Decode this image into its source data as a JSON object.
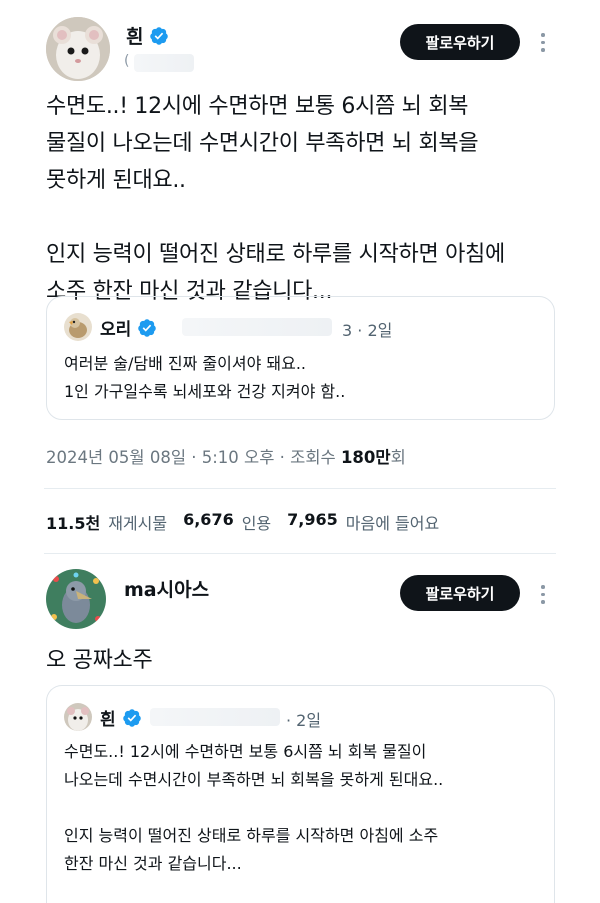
{
  "tweet1": {
    "author": "흰",
    "handle": "(",
    "follow_label": "팔로우하기",
    "text_lines": [
      "수면도..! 12시에 수면하면 보통 6시쯤 뇌 회복",
      "물질이 나오는데 수면시간이 부족하면 뇌 회복을",
      "못하게 된대요..",
      "",
      "인지 능력이 떨어진 상태로 하루를 시작하면 아침에",
      "소주 한잔 마신 것과 같습니다..."
    ],
    "quote": {
      "author": "오리",
      "date": "3 · 2일",
      "lines": [
        "여러분 술/담배 진짜 줄이셔야 돼요..",
        "1인 가구일수록 뇌세포와 건강 지켜야 함.."
      ]
    },
    "timestamp": "2024년 05월 08일 · 5:10 오후 · 조회수 ",
    "views": "180만",
    "views_suffix": "회",
    "stats": {
      "retweets": "11.5천",
      "retweets_label": "재게시물",
      "quotes": "6,676",
      "quotes_label": "인용",
      "likes": "7,965",
      "likes_label": "마음에 들어요"
    }
  },
  "tweet2": {
    "author": "ma시아스",
    "follow_label": "팔로우하기",
    "text": "오 공짜소주",
    "quote": {
      "author": "흰",
      "date": "· 2일",
      "lines": [
        "수면도..! 12시에 수면하면 보통 6시쯤 뇌 회복 물질이",
        "나오는데 수면시간이 부족하면 뇌 회복을 못하게 된대요..",
        "",
        "인지 능력이 떨어진 상태로 하루를 시작하면 아침에 소주",
        "한잔 마신 것과 같습니다..."
      ]
    }
  },
  "colors": {
    "verified": "#1d9bf0",
    "button": "#0f1419",
    "secondary_text": "#536471"
  },
  "icons": [
    "verified-badge-icon",
    "more-options-icon"
  ]
}
